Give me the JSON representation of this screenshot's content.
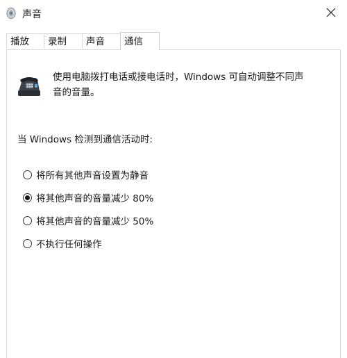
{
  "window": {
    "title": "声音",
    "title_icon": "speaker-icon",
    "close_icon": "close-icon"
  },
  "tabs": [
    {
      "label": "播放",
      "active": false
    },
    {
      "label": "录制",
      "active": false
    },
    {
      "label": "声音",
      "active": false
    },
    {
      "label": "通信",
      "active": true
    }
  ],
  "communications": {
    "icon": "telephone-icon",
    "description": "使用电脑拨打电话或接电话时，Windows 可自动调整不同声音的音量。",
    "prompt": "当 Windows 检测到通信活动时:",
    "options": [
      {
        "label": "将所有其他声音设置为静音",
        "checked": false
      },
      {
        "label": "将其他声音的音量减少 80%",
        "checked": true
      },
      {
        "label": "将其他声音的音量减少 50%",
        "checked": false
      },
      {
        "label": "不执行任何操作",
        "checked": false
      }
    ]
  },
  "colors": {
    "border": "#d9d9d9",
    "text": "#1a1a1a",
    "background": "#ffffff"
  }
}
